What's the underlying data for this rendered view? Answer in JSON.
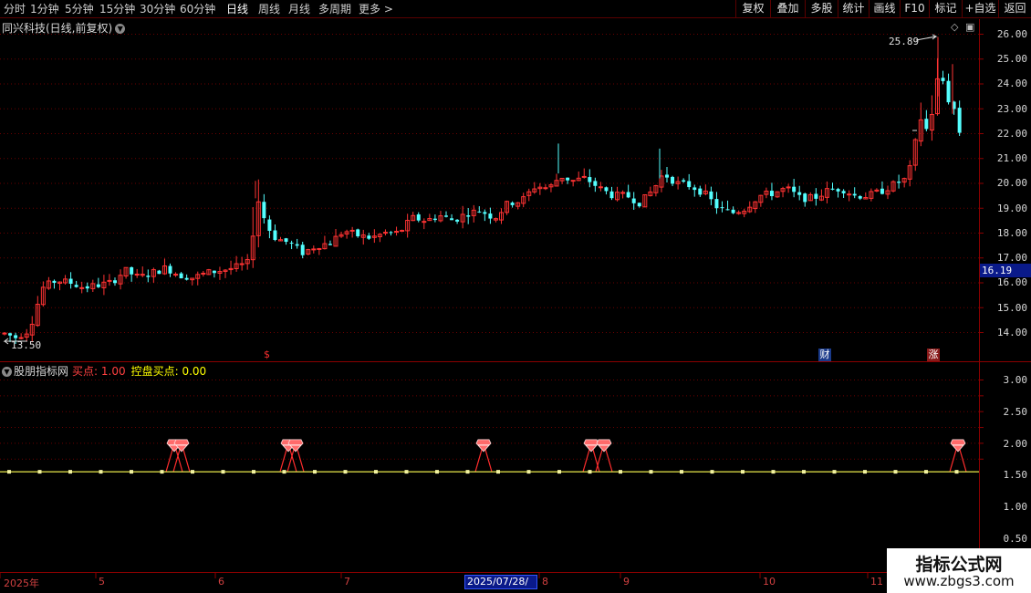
{
  "toolbar": {
    "periods": [
      "分时",
      "1分钟",
      "5分钟",
      "15分钟",
      "30分钟",
      "60分钟",
      "日线",
      "周线",
      "月线",
      "多周期",
      "更多 >"
    ],
    "active_period": "日线",
    "buttons": [
      "复权",
      "叠加",
      "多股",
      "统计",
      "画线",
      "F10",
      "标记",
      "+自选",
      "返回"
    ]
  },
  "main_chart": {
    "title": "同兴科技(日线,前复权)",
    "price_axis": [
      "26.00",
      "25.00",
      "24.00",
      "23.00",
      "22.00",
      "21.00",
      "20.00",
      "19.00",
      "18.00",
      "17.00",
      "16.00",
      "15.00",
      "14.00"
    ],
    "current_price": "16.19",
    "high_label": "25.89",
    "low_label": "13.50",
    "event_marks": {
      "dollar": "$",
      "cai": "财",
      "zhang": "涨"
    }
  },
  "indicator": {
    "name": "股朋指标网",
    "buy_point": "买点: 1.00",
    "control_buy": "控盘买点: 0.00",
    "axis": [
      "3.00",
      "2.50",
      "2.00",
      "1.50",
      "1.00",
      "0.50"
    ]
  },
  "date_axis": {
    "labels": [
      "2025年",
      "5",
      "6",
      "7",
      "8",
      "9",
      "10",
      "11"
    ],
    "cursor_date": "2025/07/28/一"
  },
  "watermark": {
    "line1": "指标公式网",
    "line2": "www.zbgs3.com"
  },
  "colors": {
    "up": "#ff3333",
    "down": "#54ffff",
    "axis": "#8b0000",
    "grid": "#6a0000",
    "signal": "#ff2d2d",
    "baseline": "#e8e84a"
  }
}
